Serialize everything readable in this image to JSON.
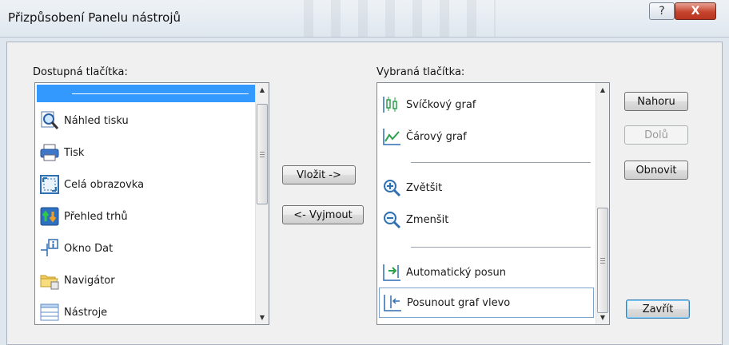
{
  "window": {
    "title": "Přizpůsobení Panelu nástrojů",
    "help_glyph": "?",
    "close_glyph": "X"
  },
  "available": {
    "label": "Dostupná tlačítka:",
    "items": [
      {
        "type": "separator",
        "selected": true
      },
      {
        "label": "Náhled tisku",
        "icon": "print-preview-icon"
      },
      {
        "label": "Tisk",
        "icon": "printer-icon"
      },
      {
        "label": "Celá obrazovka",
        "icon": "fullscreen-icon"
      },
      {
        "label": "Přehled trhů",
        "icon": "market-watch-icon"
      },
      {
        "label": "Okno Dat",
        "icon": "data-window-icon"
      },
      {
        "label": "Navigátor",
        "icon": "navigator-folder-icon"
      },
      {
        "label": "Nástroje",
        "icon": "tools-icon"
      }
    ]
  },
  "selected": {
    "label": "Vybraná tlačítka:",
    "items": [
      {
        "label": "Svíčkový graf",
        "icon": "candlestick-chart-icon"
      },
      {
        "label": "Čárový graf",
        "icon": "line-chart-icon"
      },
      {
        "type": "separator"
      },
      {
        "label": "Zvětšit",
        "icon": "zoom-in-icon"
      },
      {
        "label": "Zmenšit",
        "icon": "zoom-out-icon"
      },
      {
        "type": "separator"
      },
      {
        "label": "Automatický posun",
        "icon": "auto-scroll-icon"
      },
      {
        "label": "Posunout graf vlevo",
        "icon": "chart-shift-icon",
        "focused": true
      }
    ]
  },
  "buttons": {
    "insert": "Vložit ->",
    "remove": "<- Vyjmout",
    "up": "Nahoru",
    "down": "Dolů",
    "reset": "Obnovit",
    "close": "Zavřít"
  },
  "scroll_glyphs": {
    "up": "▲",
    "down": "▼"
  }
}
